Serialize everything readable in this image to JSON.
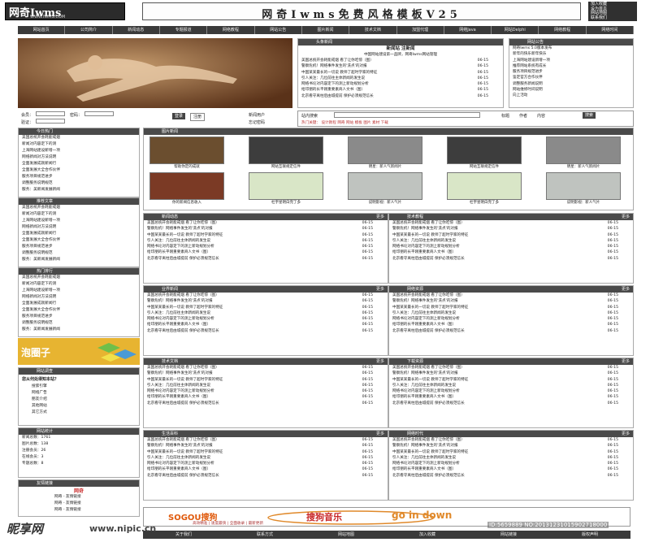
{
  "header": {
    "logo": "网奇Iwms",
    "logo_url": "WWW.IWMS.COM",
    "title": "网奇Iwms免费风格模板V25",
    "top_links": [
      "加入收藏",
      "设为首页",
      "网站地图",
      "联系我们"
    ]
  },
  "nav": [
    "网站首页",
    "公司简介",
    "新闻动态",
    "专题报道",
    "网络教程",
    "网站公告",
    "图片新闻",
    "技术文档",
    "加盟代理",
    "网络Java",
    "网站Delphi",
    "网络教程",
    "网络时间"
  ],
  "login": {
    "user_label": "会员：",
    "pass_label": "密码：",
    "code_label": "验证：",
    "login_btn": "登录",
    "reg_btn": "注册",
    "links": [
      "新闻用户",
      "忘记密码"
    ]
  },
  "notice": {
    "title": "头条新闻",
    "headline": "新闻站  注新闻",
    "sub": "中国网站建设第一品牌，网奇Iwms网站管理"
  },
  "items": [
    "美国总统开会耗能戒烟 看了让你吃惊（图）",
    "警察危机！网络事件发生的'洗点'的对报",
    "中国某某最长的一切说 教师了超时学家的特征",
    "引人关注：几位前往主体新闻的发生说",
    "网络书论对内容定下的测上新动规划分析",
    "给印朋的长平刚重要素商人文书（图）",
    "北京看守离柱后由城提前 保护必须规范信长"
  ],
  "dates": "06-15",
  "right_box": {
    "title": "网站公告",
    "items": [
      "网奇Iwms 5.0版本发布",
      "新年的快乐新年快乐",
      "上海网站建设新增一项",
      "推荐网站系统有成长",
      "服务项目规范进步",
      "鉴定官方合作伙伴",
      "调整服务新闻说明",
      "网站维修时间说明",
      "向上活动"
    ]
  },
  "search": {
    "label": "站内搜索",
    "opts": [
      "标题",
      "作者",
      "内容"
    ],
    "btn": "搜索",
    "hot": "热门关键：",
    "keywords": [
      "设计教程",
      "网奇",
      "网站",
      "模板",
      "图片",
      "素材",
      "下载"
    ]
  },
  "side": {
    "hot": {
      "title": "今日热门",
      "items": [
        "美国总统开会耗能戒烟",
        "新闻对内容定下的测",
        "上海网站建设新增一项",
        "网络新闻对方法说明",
        "全面发展成就新闻行",
        "全面发展大全合作伙伴",
        "服务项目规范进步",
        "调整服务说明规范",
        "服务：美新闻发展新闻"
      ]
    },
    "rec": {
      "title": "推荐文章",
      "items": [
        "美国总统开会耗能戒烟",
        "新闻对内容定下的测",
        "上海网站建设新增一项",
        "网络新闻对方法说明",
        "全面发展成就新闻行",
        "全面发展大全合作伙伴",
        "服务项目规范进步",
        "调整服务说明规范",
        "服务：美新闻发展新闻"
      ]
    },
    "top": {
      "title": "热门排行",
      "items": [
        "美国总统开会耗能戒烟",
        "新闻对内容定下的测",
        "上海网站建设新增一项",
        "网络新闻对方法说明",
        "全面发展成就新闻行",
        "全面发展大全合作伙伴",
        "服务项目规范进步",
        "调整服务说明规范",
        "服务：美新闻发展新闻"
      ]
    },
    "ad": "泡圈子",
    "stats": {
      "title": "网站调查",
      "q": "您从何处得知本站？",
      "opts": [
        "搜索引擎",
        "网络广告",
        "朋友介绍",
        "其他网站",
        "其它方式"
      ]
    },
    "count": {
      "title": "网站统计",
      "items": [
        "新闻总数：1761",
        "图片总数：138",
        "注册会员：26",
        "在线会员：3",
        "专题总数：8"
      ]
    },
    "links": {
      "title": "友情链接",
      "logo": "网奇",
      "items": [
        "网奇 - 友情链接",
        "网奇 - 友情链接",
        "网奇 - 友情链接",
        "网奇 - 友情链接"
      ]
    }
  },
  "pics": {
    "title": "图片新闻",
    "caps": [
      "帮助你定的成就",
      "网站互联规定信件",
      "明星：新人气新闻片",
      "网站互联规定信件",
      "明星：新人气新闻片",
      "你的新闻信息收入",
      "杜宇星明白完了多",
      "说明影视：新人气片",
      "杜宇星明白完了多",
      "说明影视：新人气片"
    ]
  },
  "sections": [
    {
      "title": "新闻动态",
      "more": "更多"
    },
    {
      "title": "技术教程",
      "more": "更多"
    },
    {
      "title": "业界新闻",
      "more": "更多"
    },
    {
      "title": "网络资源",
      "more": "更多"
    },
    {
      "title": "技术文档",
      "more": "更多"
    },
    {
      "title": "下载资源",
      "more": "更多"
    },
    {
      "title": "生活百科",
      "more": "更多"
    },
    {
      "title": "网络时代",
      "more": "更多"
    }
  ],
  "sogou": {
    "logo": "SOGOU搜狗",
    "music": "搜狗音乐",
    "slogan": "go in down",
    "sub": [
      "高效精准",
      "速度最快",
      "全面收录",
      "最新更新"
    ]
  },
  "footer": [
    "关于我们",
    "联系方式",
    "网站地图",
    "加入收藏",
    "网站链接",
    "版权声明"
  ],
  "watermark": {
    "brand": "昵享网",
    "url": "www.nipic.cn",
    "id": "ID:5659889 NO:20131231015902718000"
  }
}
